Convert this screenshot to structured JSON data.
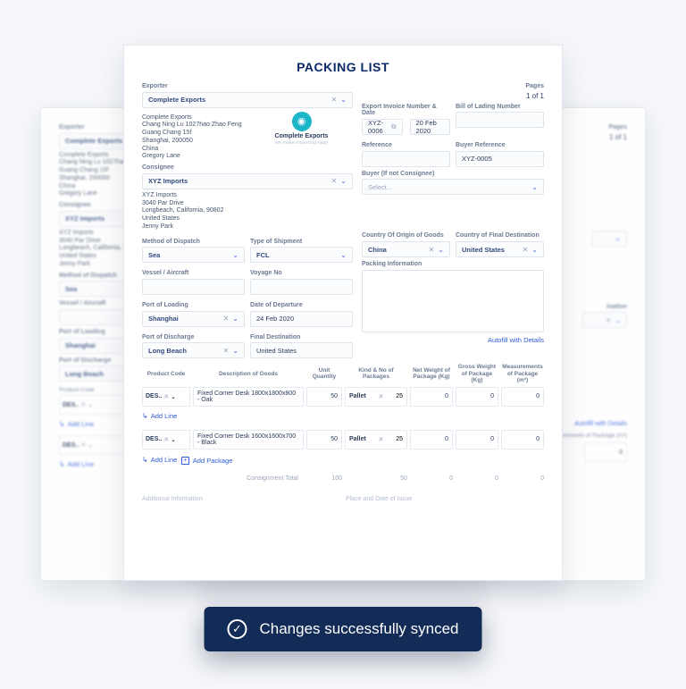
{
  "doc": {
    "title": "PACKING LIST"
  },
  "labels": {
    "exporter": "Exporter",
    "pages": "Pages",
    "pages_value": "1 of 1",
    "invoice": "Export Invoice Number & Date",
    "bol": "Bill of Lading Number",
    "reference": "Reference",
    "buyer_ref": "Buyer Reference",
    "consignee": "Consignee",
    "buyer_if": "Buyer (If not Consignee)",
    "select_placeholder": "Select...",
    "method": "Method of Dispatch",
    "shiptype": "Type of Shipment",
    "origin": "Country Of Origin of Goods",
    "dest": "Country of Final Destination",
    "vessel": "Vessel / Aircraft",
    "voyage": "Voyage No",
    "packinfo": "Packing Information",
    "pol": "Port of Loading",
    "dod": "Date of Departure",
    "pod": "Port of Discharge",
    "finaldest": "Final Destination",
    "autofill": "Autofill with Details",
    "addline": "Add Line",
    "addpkg": "Add Package",
    "total": "Consignment Total",
    "addinfo": "Additional Information",
    "place_issue": "Place and Date of Issue",
    "product_code": "Product Code",
    "descgoods": "Description of Goods",
    "unitqty": "Unit Quantity",
    "kind": "Kind & No of Packages",
    "netw": "Net Weight of Package (Kg)",
    "grossw": "Gross Weight of Package (Kg)",
    "meas": "Measurements of Package (m³)"
  },
  "exporter": {
    "select": "Complete Exports",
    "address": "Complete Exports\nChang Ning Lu 1027hao Zhao Feng\nGuang Chang 15f\nShanghai,  200050\nChina\nGregory Lane",
    "logo_name": "Complete Exports",
    "logo_sub": "we make exporting easy"
  },
  "invoice": {
    "number": "XYZ-0006",
    "date": "20 Feb 2020"
  },
  "buyer_reference": "XYZ-0005",
  "consignee": {
    "select": "XYZ Imports",
    "address": "XYZ Imports\n3040  Par Drive\nLongbeach, California, 90802\nUnited States\nJenny Park"
  },
  "shipment": {
    "method": "Sea",
    "type": "FCL",
    "origin": "China",
    "destination": "United States",
    "pol": "Shanghai",
    "dod": "24 Feb 2020",
    "pod": "Long Beach",
    "finaldest": "United States"
  },
  "table": {
    "rows": [
      {
        "code": "DES..",
        "desc": "Fixed Corner Desk 1800x1800x800 - Oak",
        "qty": 50,
        "kind": "Pallet",
        "kind_qty": 25,
        "net": 0,
        "gross": 0,
        "meas": 0
      },
      {
        "code": "DES..",
        "desc": "Fixed Corner Desk 1600x1600x700 - Black",
        "qty": 50,
        "kind": "Pallet",
        "kind_qty": 25,
        "net": 0,
        "gross": 0,
        "meas": 0
      }
    ],
    "totals": {
      "qty": 100,
      "pkgs": 50,
      "net": 0,
      "gross": 0,
      "meas": 0
    }
  },
  "toast": {
    "message": "Changes successfully synced"
  },
  "bg_right": {
    "meas_val": 0
  }
}
